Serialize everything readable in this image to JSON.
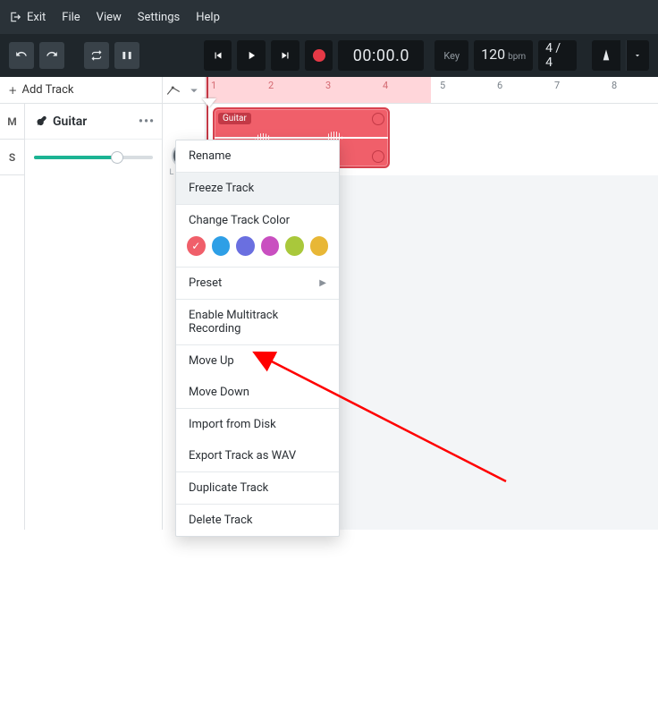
{
  "menubar": {
    "exit": "Exit",
    "items": [
      "File",
      "View",
      "Settings",
      "Help"
    ]
  },
  "toolbar": {
    "key_label": "Key",
    "tempo": "120",
    "tempo_unit": "bpm",
    "timesig": "4 / 4",
    "timecode": "00:00.0"
  },
  "addtrack": {
    "label": "Add Track"
  },
  "ruler": {
    "ticks": [
      "1",
      "2",
      "3",
      "4",
      "5",
      "6",
      "7",
      "8"
    ]
  },
  "track": {
    "name": "Guitar",
    "m": "M",
    "s": "S",
    "clip_label": "Guitar"
  },
  "ctx": {
    "rename": "Rename",
    "freeze": "Freeze Track",
    "change_color": "Change Track Color",
    "colors": [
      "#f05f6a",
      "#2e9fe6",
      "#6a6fe0",
      "#c94fc0",
      "#a9c83b",
      "#e8b736"
    ],
    "preset": "Preset",
    "multitrack": "Enable Multitrack Recording",
    "move_up": "Move Up",
    "move_down": "Move Down",
    "import_disk": "Import from Disk",
    "export_wav": "Export Track as WAV",
    "duplicate": "Duplicate Track",
    "delete": "Delete Track"
  }
}
